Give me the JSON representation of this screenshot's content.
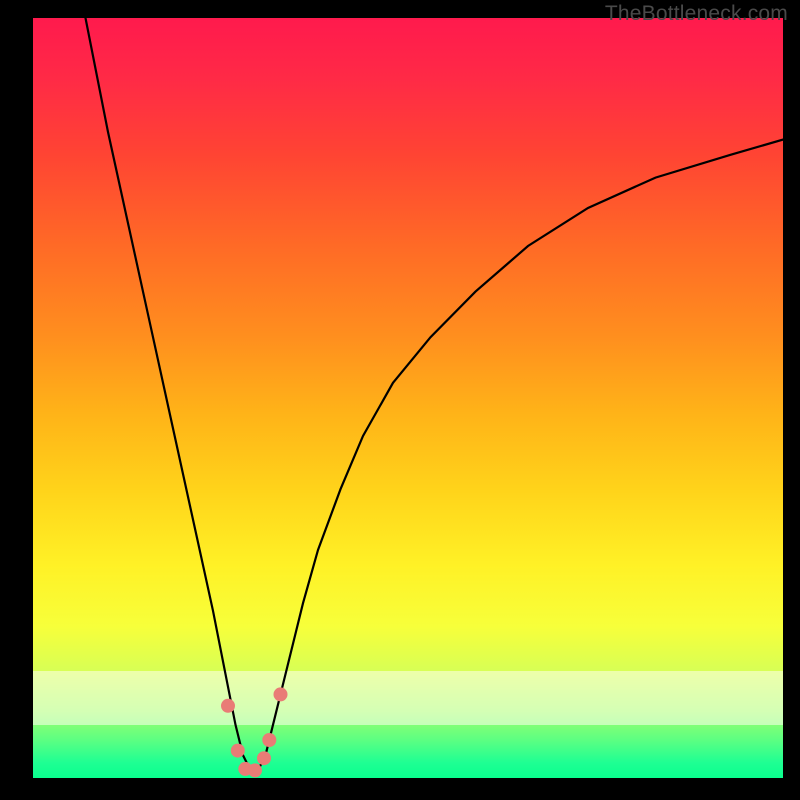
{
  "watermark": "TheBottleneck.com",
  "colors": {
    "frame": "#000000",
    "curve": "#000000",
    "dot": "#e97c76",
    "dot_stroke": "#d45f59",
    "overlay_band": "rgba(255,255,240,0.55)"
  },
  "chart_data": {
    "type": "line",
    "title": "",
    "xlabel": "",
    "ylabel": "",
    "xlim": [
      0,
      100
    ],
    "ylim": [
      0,
      100
    ],
    "overlay_band_y": [
      7,
      14
    ],
    "series": [
      {
        "name": "bottleneck-curve",
        "x": [
          7,
          8,
          10,
          12,
          14,
          16,
          18,
          20,
          22,
          24,
          25,
          26,
          27,
          28,
          29,
          30,
          31,
          32,
          34,
          36,
          38,
          41,
          44,
          48,
          53,
          59,
          66,
          74,
          83,
          93,
          100
        ],
        "y": [
          100,
          95,
          85,
          76,
          67,
          58,
          49,
          40,
          31,
          22,
          17,
          12,
          7,
          3,
          1,
          1,
          3,
          7,
          15,
          23,
          30,
          38,
          45,
          52,
          58,
          64,
          70,
          75,
          79,
          82,
          84
        ]
      }
    ],
    "dots": [
      {
        "x": 26.0,
        "y": 9.5
      },
      {
        "x": 27.3,
        "y": 3.6
      },
      {
        "x": 28.3,
        "y": 1.2
      },
      {
        "x": 29.6,
        "y": 1.0
      },
      {
        "x": 30.8,
        "y": 2.6
      },
      {
        "x": 31.5,
        "y": 5.0
      },
      {
        "x": 33.0,
        "y": 11.0
      }
    ]
  }
}
